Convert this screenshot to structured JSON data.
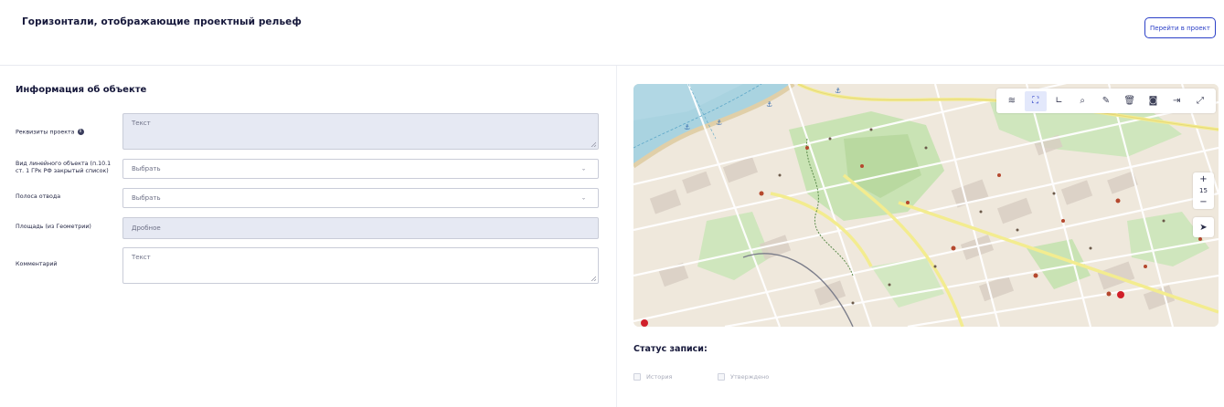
{
  "header": {
    "title": "Горизонтали, отображающие проектный рельеф",
    "go_to_project_label": "Перейти в проект"
  },
  "section": {
    "title": "Информация об объекте"
  },
  "form": {
    "fields": [
      {
        "label": "Реквизиты проекта",
        "type": "textarea",
        "value": "",
        "placeholder": "Текст"
      },
      {
        "label_line1": "Вид линейного объекта (п.10.1",
        "label_line2": "ст. 1 ГРк РФ закрытый список)",
        "type": "select",
        "value": "Выбрать"
      },
      {
        "label": "Полоса отвода",
        "type": "select",
        "value": "Выбрать"
      },
      {
        "label": "Площадь (из Геометрии)",
        "type": "readonly",
        "value": "Дробное"
      },
      {
        "label": "Комментарий",
        "type": "textarea",
        "value": "",
        "placeholder": "Текст"
      }
    ]
  },
  "map": {
    "zoom_level": "15",
    "toolbar_icons": [
      "layers-icon",
      "select-area-icon",
      "measure-angle-icon",
      "search-icon",
      "pencil-icon",
      "trash-icon",
      "camera-icon",
      "export-icon",
      "fullscreen-icon"
    ],
    "active_tool": "select-area-icon",
    "colors": {
      "water": "#a9d3e0",
      "land": "#efe8dc",
      "park": "#c9e3b4",
      "road_major": "#f7f2a6",
      "road_minor": "#ffffff",
      "building": "#d9cfc4"
    }
  },
  "status": {
    "title": "Статус записи:",
    "checkboxes": [
      {
        "label": "История",
        "checked": false
      },
      {
        "label": "Утверждено",
        "checked": false
      }
    ]
  },
  "colors": {
    "accent": "#2b3fc7",
    "readonly_bg": "#e6e9f3"
  }
}
